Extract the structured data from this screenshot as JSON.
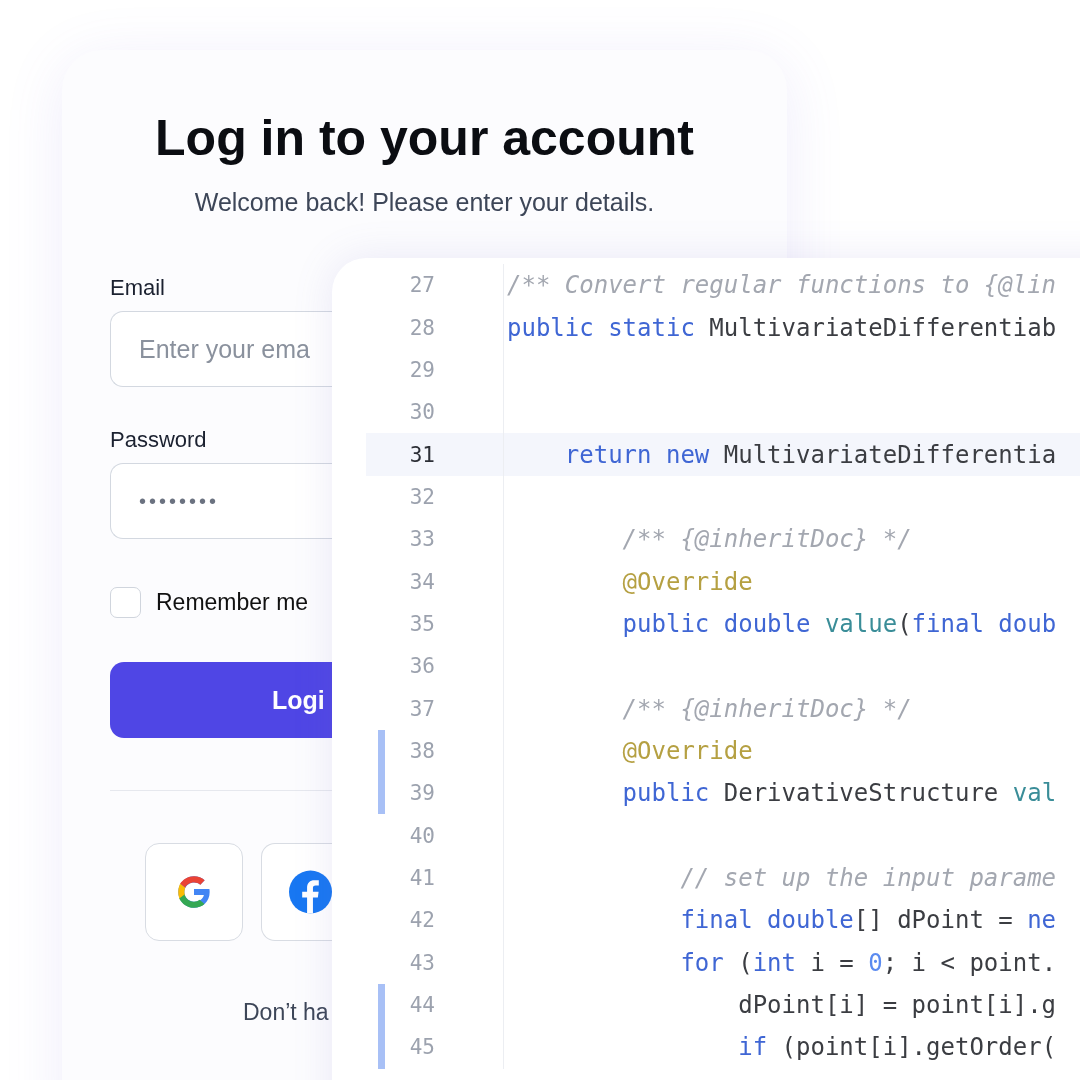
{
  "login": {
    "title": "Log in to your account",
    "subtitle": "Welcome back! Please enter your details.",
    "fields": [
      {
        "label": "Email",
        "kind": "text",
        "placeholder": "Enter your ema"
      },
      {
        "label": "Password",
        "kind": "password",
        "value": "••••••••"
      }
    ],
    "remember": {
      "label": "Remember me",
      "checked": false
    },
    "submit": "Logi",
    "social": [
      {
        "kind": "google"
      },
      {
        "kind": "facebook"
      }
    ],
    "footer": "Don’t ha"
  },
  "editor": {
    "lines": [
      {
        "number": "27",
        "selected": false,
        "changed": false,
        "tokens": [
          {
            "kind": "comment",
            "text": "/** Convert regular functions to {@lin"
          }
        ]
      },
      {
        "number": "28",
        "selected": false,
        "changed": false,
        "tokens": [
          {
            "kind": "keyword",
            "text": "public static"
          },
          {
            "kind": "plain",
            "text": " MultivariateDifferentiab"
          }
        ]
      },
      {
        "number": "29",
        "selected": false,
        "changed": false
      },
      {
        "number": "30",
        "selected": false,
        "changed": false
      },
      {
        "number": "31",
        "selected": true,
        "changed": false,
        "tokens": [
          {
            "kind": "keyword",
            "text": "    return new"
          },
          {
            "kind": "plain",
            "text": " MultivariateDifferentia"
          }
        ]
      },
      {
        "number": "32",
        "selected": false,
        "changed": false
      },
      {
        "number": "33",
        "selected": false,
        "changed": false,
        "tokens": [
          {
            "kind": "comment",
            "text": "        /** {@inheritDoc} */"
          }
        ]
      },
      {
        "number": "34",
        "selected": false,
        "changed": false,
        "tokens": [
          {
            "kind": "annotation",
            "text": "        @Override"
          }
        ]
      },
      {
        "number": "35",
        "selected": false,
        "changed": false,
        "tokens": [
          {
            "kind": "keyword",
            "text": "        public double "
          },
          {
            "kind": "method",
            "text": "value"
          },
          {
            "kind": "plain",
            "text": "("
          },
          {
            "kind": "keyword",
            "text": "final doub"
          }
        ]
      },
      {
        "number": "36",
        "selected": false,
        "changed": false
      },
      {
        "number": "37",
        "selected": false,
        "changed": false,
        "tokens": [
          {
            "kind": "comment",
            "text": "        /** {@inheritDoc} */"
          }
        ]
      },
      {
        "number": "38",
        "selected": false,
        "changed": true,
        "tokens": [
          {
            "kind": "annotation",
            "text": "        @Override"
          }
        ]
      },
      {
        "number": "39",
        "selected": false,
        "changed": true,
        "tokens": [
          {
            "kind": "keyword",
            "text": "        public"
          },
          {
            "kind": "plain",
            "text": " DerivativeStructure "
          },
          {
            "kind": "method",
            "text": "val"
          }
        ]
      },
      {
        "number": "40",
        "selected": false,
        "changed": false
      },
      {
        "number": "41",
        "selected": false,
        "changed": false,
        "tokens": [
          {
            "kind": "comment",
            "text": "            // set up the input parame"
          }
        ]
      },
      {
        "number": "42",
        "selected": false,
        "changed": false,
        "tokens": [
          {
            "kind": "keyword",
            "text": "            final double"
          },
          {
            "kind": "plain",
            "text": "[] dPoint = "
          },
          {
            "kind": "keyword",
            "text": "ne"
          }
        ]
      },
      {
        "number": "43",
        "selected": false,
        "changed": false,
        "tokens": [
          {
            "kind": "keyword",
            "text": "            for"
          },
          {
            "kind": "plain",
            "text": " ("
          },
          {
            "kind": "keyword",
            "text": "int"
          },
          {
            "kind": "plain",
            "text": " i = "
          },
          {
            "kind": "number",
            "text": "0"
          },
          {
            "kind": "plain",
            "text": "; i < point."
          }
        ]
      },
      {
        "number": "44",
        "selected": false,
        "changed": true,
        "tokens": [
          {
            "kind": "plain",
            "text": "                dPoint[i] = point[i].g"
          }
        ]
      },
      {
        "number": "45",
        "selected": false,
        "changed": true,
        "tokens": [
          {
            "kind": "keyword",
            "text": "                if"
          },
          {
            "kind": "plain",
            "text": " (point[i].getOrder("
          }
        ]
      }
    ]
  }
}
